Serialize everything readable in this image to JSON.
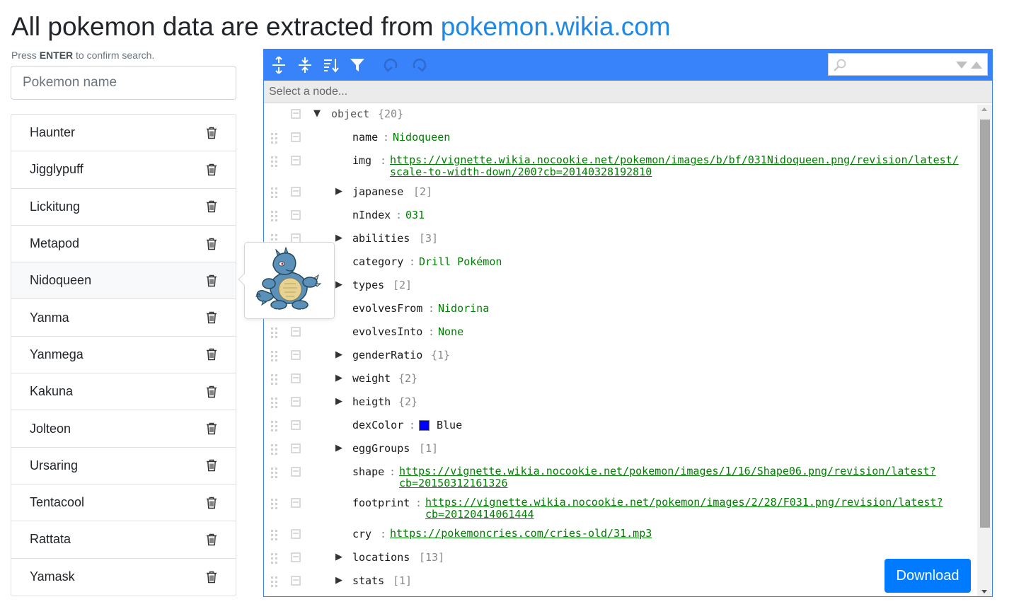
{
  "header": {
    "title_prefix": "All pokemon data are extracted from ",
    "title_link": "pokemon.wikia.com"
  },
  "search": {
    "hint_prefix": "Press ",
    "hint_key": "ENTER",
    "hint_suffix": " to confirm search.",
    "placeholder": "Pokemon name",
    "value": ""
  },
  "pokemon_list": [
    {
      "name": "Haunter"
    },
    {
      "name": "Jigglypuff"
    },
    {
      "name": "Lickitung"
    },
    {
      "name": "Metapod"
    },
    {
      "name": "Nidoqueen",
      "active": true
    },
    {
      "name": "Yanma"
    },
    {
      "name": "Yanmega"
    },
    {
      "name": "Kakuna"
    },
    {
      "name": "Jolteon"
    },
    {
      "name": "Ursaring"
    },
    {
      "name": "Tentacool"
    },
    {
      "name": "Rattata"
    },
    {
      "name": "Yamask"
    }
  ],
  "editor": {
    "accent_color": "#3883fa",
    "toolbar_icons": [
      "expand-all-icon",
      "collapse-all-icon",
      "sort-icon",
      "filter-icon",
      "undo-icon",
      "redo-icon"
    ],
    "search_value": "",
    "navbar_text": "Select a node...",
    "root_label": "object",
    "root_count": "{20}",
    "rows": {
      "name": {
        "key": "name",
        "value": "Nidoqueen"
      },
      "img": {
        "key": "img",
        "line1": "https://vignette.wikia.nocookie.net/pokemon/images/b/bf/031Nidoqueen.png/revision/latest/",
        "line2": "scale-to-width-down/200?cb=20140328192810"
      },
      "japanese": {
        "key": "japanese",
        "count": "[2]"
      },
      "nIndex": {
        "key": "nIndex",
        "value": "031"
      },
      "abilities": {
        "key": "abilities",
        "count": "[3]"
      },
      "category": {
        "key": "category",
        "value": "Drill Pokémon"
      },
      "types": {
        "key": "types",
        "count": "[2]"
      },
      "evolvesFrom": {
        "key": "evolvesFrom",
        "value": "Nidorina"
      },
      "evolvesInto": {
        "key": "evolvesInto",
        "value": "None"
      },
      "genderRatio": {
        "key": "genderRatio",
        "count": "{1}"
      },
      "weight": {
        "key": "weight",
        "count": "{2}"
      },
      "heigth": {
        "key": "heigth",
        "count": "{2}"
      },
      "dexColor": {
        "key": "dexColor",
        "value": "Blue",
        "swatch": "#0000ff"
      },
      "eggGroups": {
        "key": "eggGroups",
        "count": "[1]"
      },
      "shape": {
        "key": "shape",
        "line1": "https://vignette.wikia.nocookie.net/pokemon/images/1/16/Shape06.png/revision/latest?",
        "line2": "cb=20150312161326"
      },
      "footprint": {
        "key": "footprint",
        "line1": "https://vignette.wikia.nocookie.net/pokemon/images/2/28/F031.png/revision/latest?",
        "line2": "cb=20120414061444"
      },
      "cry": {
        "key": "cry",
        "line1": "https://pokemoncries.com/cries-old/31.mp3"
      },
      "locations": {
        "key": "locations",
        "count": "[13]"
      },
      "stats": {
        "key": "stats",
        "count": "[1]"
      }
    }
  },
  "download_label": "Download",
  "colors": {
    "link_blue": "#1e88e5",
    "button_blue": "#007bff",
    "value_green": "#008000"
  }
}
